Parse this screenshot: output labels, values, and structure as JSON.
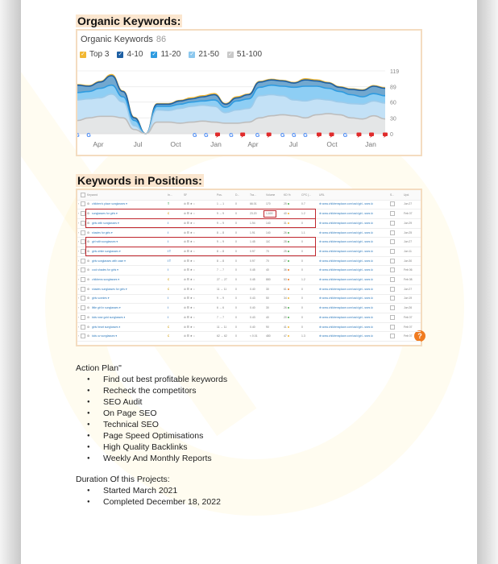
{
  "sections": {
    "organic_title": "Organic Keywords:",
    "positions_title": "Keywords in Positions:"
  },
  "organic_chart": {
    "header_label": "Organic Keywords",
    "header_count": "86",
    "legend": [
      {
        "label": "Top 3",
        "color": "#f2b732"
      },
      {
        "label": "4-10",
        "color": "#1d5fa3"
      },
      {
        "label": "11-20",
        "color": "#2e9be0"
      },
      {
        "label": "21-50",
        "color": "#8cc8ee"
      },
      {
        "label": "51-100",
        "color": "#c9c9c9"
      }
    ]
  },
  "chart_data": {
    "type": "area",
    "title": "Organic Keywords",
    "stacked": true,
    "x_tick_labels": [
      "Apr",
      "Jul",
      "Oct",
      "Jan",
      "Apr",
      "Jul",
      "Oct",
      "Jan"
    ],
    "y_tick_labels": [
      "119",
      "89",
      "60",
      "30",
      "0"
    ],
    "ylim": [
      0,
      119
    ],
    "grid": true,
    "legend_position": "top-left",
    "x_points": 28,
    "series": [
      {
        "name": "51-100",
        "color": "#e6e6e6",
        "values": [
          25,
          30,
          33,
          33,
          30,
          8,
          0,
          22,
          22,
          20,
          22,
          24,
          22,
          20,
          20,
          22,
          30,
          34,
          36,
          34,
          30,
          36,
          38,
          36,
          30,
          28,
          34,
          28
        ]
      },
      {
        "name": "21-50",
        "color": "#c6e2f6",
        "values": [
          64,
          66,
          68,
          75,
          60,
          15,
          0,
          45,
          44,
          48,
          52,
          54,
          52,
          40,
          45,
          48,
          72,
          74,
          72,
          64,
          62,
          66,
          64,
          60,
          57,
          56,
          62,
          58
        ]
      },
      {
        "name": "11-20",
        "color": "#8fd0f5",
        "values": [
          78,
          80,
          86,
          92,
          70,
          25,
          0,
          52,
          52,
          56,
          60,
          62,
          64,
          50,
          62,
          66,
          88,
          92,
          90,
          88,
          90,
          90,
          86,
          80,
          74,
          70,
          76,
          72
        ]
      },
      {
        "name": "4-10",
        "color": "#6aa7d8",
        "values": [
          92,
          90,
          98,
          110,
          80,
          30,
          0,
          56,
          56,
          62,
          66,
          70,
          74,
          56,
          68,
          74,
          98,
          102,
          100,
          96,
          102,
          100,
          96,
          88,
          84,
          82,
          90,
          86
        ]
      },
      {
        "name": "Top 3",
        "color": "#f2b732",
        "values": [
          93,
          91,
          99,
          112,
          81,
          31,
          0,
          57,
          57,
          63,
          68,
          72,
          76,
          57,
          70,
          75,
          99,
          103,
          101,
          97,
          104,
          102,
          97,
          89,
          85,
          83,
          91,
          87
        ]
      }
    ],
    "event_markers": [
      "google",
      "google",
      "google",
      "google",
      "note",
      "google",
      "note",
      "google",
      "note",
      "google",
      "google",
      "google",
      "note",
      "note",
      "google",
      "note",
      "note",
      "note"
    ]
  },
  "keywords_table": {
    "columns": [
      "Keyword",
      "In...",
      "SF",
      "Pos.",
      "D...",
      "Tra...",
      "Volume",
      "KD %",
      "CPC (...",
      "URL",
      "S...",
      "Upd."
    ],
    "rows": [
      {
        "keyword": "children's place sunglasses",
        "intent": "T",
        "pos": "1 → 1",
        "diff": "0",
        "traffic": "66.01",
        "volume": "170",
        "kd": "25",
        "kd_color": "#4caf50",
        "cpc": "0.7",
        "url": "www.childrensplace.com/us/c/girl...sses",
        "updated": "Jun 27",
        "highlight": false
      },
      {
        "keyword": "sunglasses for girls",
        "intent": "C",
        "pos": "9 → 9",
        "diff": "0",
        "traffic": "23.20",
        "volume": "1,600",
        "kd": "40",
        "kd_color": "#f2b732",
        "cpc": "1.2",
        "url": "www.childrensplace.com/us/c/girl...sses",
        "updated": "Feb 07",
        "highlight": true
      },
      {
        "keyword": "girls with sunglasses",
        "intent": "I",
        "pos": "9 → 9",
        "diff": "0",
        "traffic": "1.94",
        "volume": "140",
        "kd": "31",
        "kd_color": "#f2b732",
        "cpc": "0",
        "url": "www.childrensplace.com/us/c/girl...sses",
        "updated": "Jun 29",
        "highlight": true
      },
      {
        "keyword": "shades for girls",
        "intent": "I",
        "pos": "8 → 8",
        "diff": "0",
        "traffic": "1.91",
        "volume": "140",
        "kd": "26",
        "kd_color": "#4caf50",
        "cpc": "1.1",
        "url": "www.childrensplace.com/us/c/girl...sses",
        "updated": "Jun 25",
        "highlight": false
      },
      {
        "keyword": "girl with sunglasses",
        "intent": "I",
        "pos": "9 → 9",
        "diff": "0",
        "traffic": "1.45",
        "volume": "110",
        "kd": "28",
        "kd_color": "#4caf50",
        "cpc": "0",
        "url": "www.childrensplace.com/us/c/girl...sses",
        "updated": "Jun 27",
        "highlight": true
      },
      {
        "keyword": "girls white sunglasses",
        "intent": "I T",
        "pos": "8 → 8",
        "diff": "0",
        "traffic": "0.97",
        "volume": "70",
        "kd": "25",
        "kd_color": "#4caf50",
        "cpc": "0",
        "url": "www.childrensplace.com/us/c/girl...sses",
        "updated": "Jun 11",
        "highlight": true
      },
      {
        "keyword": "girls sunglasses with case",
        "intent": "I T",
        "pos": "8 → 8",
        "diff": "0",
        "traffic": "0.97",
        "volume": "70",
        "kd": "27",
        "kd_color": "#4caf50",
        "cpc": "0",
        "url": "www.childrensplace.com/us/c/girl...sses",
        "updated": "Jun 30",
        "highlight": false
      },
      {
        "keyword": "cool shades for girls",
        "intent": "I",
        "pos": "7 → 7",
        "diff": "0",
        "traffic": "0.45",
        "volume": "40",
        "kd": "36",
        "kd_color": "#f07b20",
        "cpc": "0",
        "url": "www.childrensplace.com/us/c/girl...sses",
        "updated": "Feb 06",
        "highlight": false
      },
      {
        "keyword": "childrens sunglasses",
        "intent": "C",
        "pos": "27 → 27",
        "diff": "0",
        "traffic": "0.45",
        "volume": "880",
        "kd": "53",
        "kd_color": "#f07b20",
        "cpc": "1.2",
        "url": "www.childrensplace.com/us/c/girl...sses",
        "updated": "Feb 08",
        "highlight": false
      },
      {
        "keyword": "shades sunglasses for girls",
        "intent": "C",
        "pos": "11 → 11",
        "diff": "0",
        "traffic": "0.40",
        "volume": "30",
        "kd": "61",
        "kd_color": "#f07b20",
        "cpc": "0",
        "url": "www.childrensplace.com/us/c/girl...sses",
        "updated": "Jun 27",
        "highlight": false
      },
      {
        "keyword": "girls sunnies",
        "intent": "I",
        "pos": "9 → 9",
        "diff": "0",
        "traffic": "0.43",
        "volume": "50",
        "kd": "34",
        "kd_color": "#f2b732",
        "cpc": "0",
        "url": "www.childrensplace.com/us/c/girl...sses",
        "updated": "Jun 19",
        "highlight": false
      },
      {
        "keyword": "little girl in sunglasses",
        "intent": "I",
        "pos": "6 → 6",
        "diff": "0",
        "traffic": "0.40",
        "volume": "30",
        "kd": "26",
        "kd_color": "#4caf50",
        "cpc": "0",
        "url": "www.childrensplace.com/us/c/girl...sses",
        "updated": "Jun 26",
        "highlight": false
      },
      {
        "keyword": "kids rose gold sunglasses",
        "intent": "I",
        "pos": "7 → 7",
        "diff": "0",
        "traffic": "0.43",
        "volume": "40",
        "kd": "20",
        "kd_color": "#4caf50",
        "cpc": "0",
        "url": "www.childrensplace.com/us/c/girl...sses",
        "updated": "Feb 07",
        "highlight": false
      },
      {
        "keyword": "girls heart sunglasses",
        "intent": "C",
        "pos": "11 → 11",
        "diff": "0",
        "traffic": "0.40",
        "volume": "90",
        "kd": "41",
        "kd_color": "#f2b732",
        "cpc": "0",
        "url": "www.childrensplace.com/us/c/girl...sses",
        "updated": "Feb 07",
        "highlight": false
      },
      {
        "keyword": "kids uv sunglasses",
        "intent": "C",
        "pos": "62 → 62",
        "diff": "0",
        "traffic": "< 0.01",
        "volume": "480",
        "kd": "47",
        "kd_color": "#f2b732",
        "cpc": "1.3",
        "url": "www.childrensplace.com/us/c/girl...sses",
        "updated": "Feb 07",
        "highlight": false
      }
    ],
    "help_button": "?"
  },
  "action_plan": {
    "title": "Action Plan\"",
    "items": [
      "Find out best profitable keywords",
      "Recheck the competitors",
      "SEO Audit",
      "On Page SEO",
      "Technical SEO",
      "Page Speed Optimisations",
      "High Quality Backlinks",
      "Weekly And Monthly Reports"
    ]
  },
  "duration": {
    "title": "Duration Of this Projects:",
    "items": [
      "Started March 2021",
      "Completed December 18, 2022"
    ]
  }
}
